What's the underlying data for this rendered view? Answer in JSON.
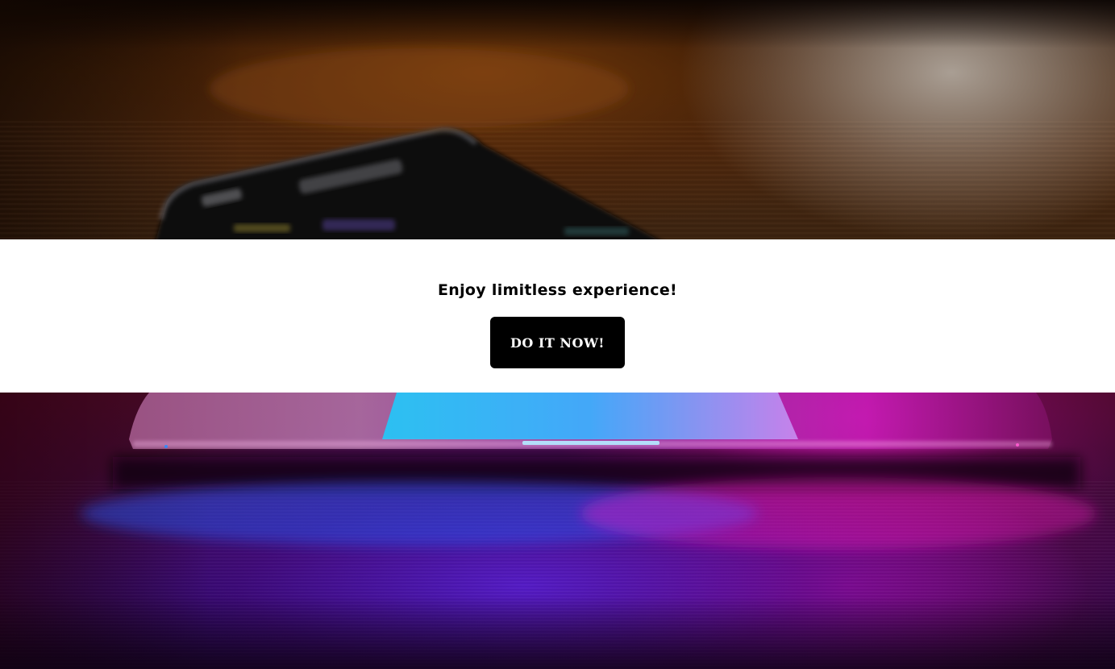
{
  "promo": {
    "heading": "Enjoy limitless experience!",
    "cta_label": "DO IT NOW!"
  },
  "colors": {
    "band_background": "#ffffff",
    "heading_text": "#000000",
    "button_background": "#000000",
    "button_text": "#ffffff"
  },
  "images": {
    "top": "blurred-phone-on-table-photo",
    "bottom": "laptop-neon-glow-photo"
  }
}
